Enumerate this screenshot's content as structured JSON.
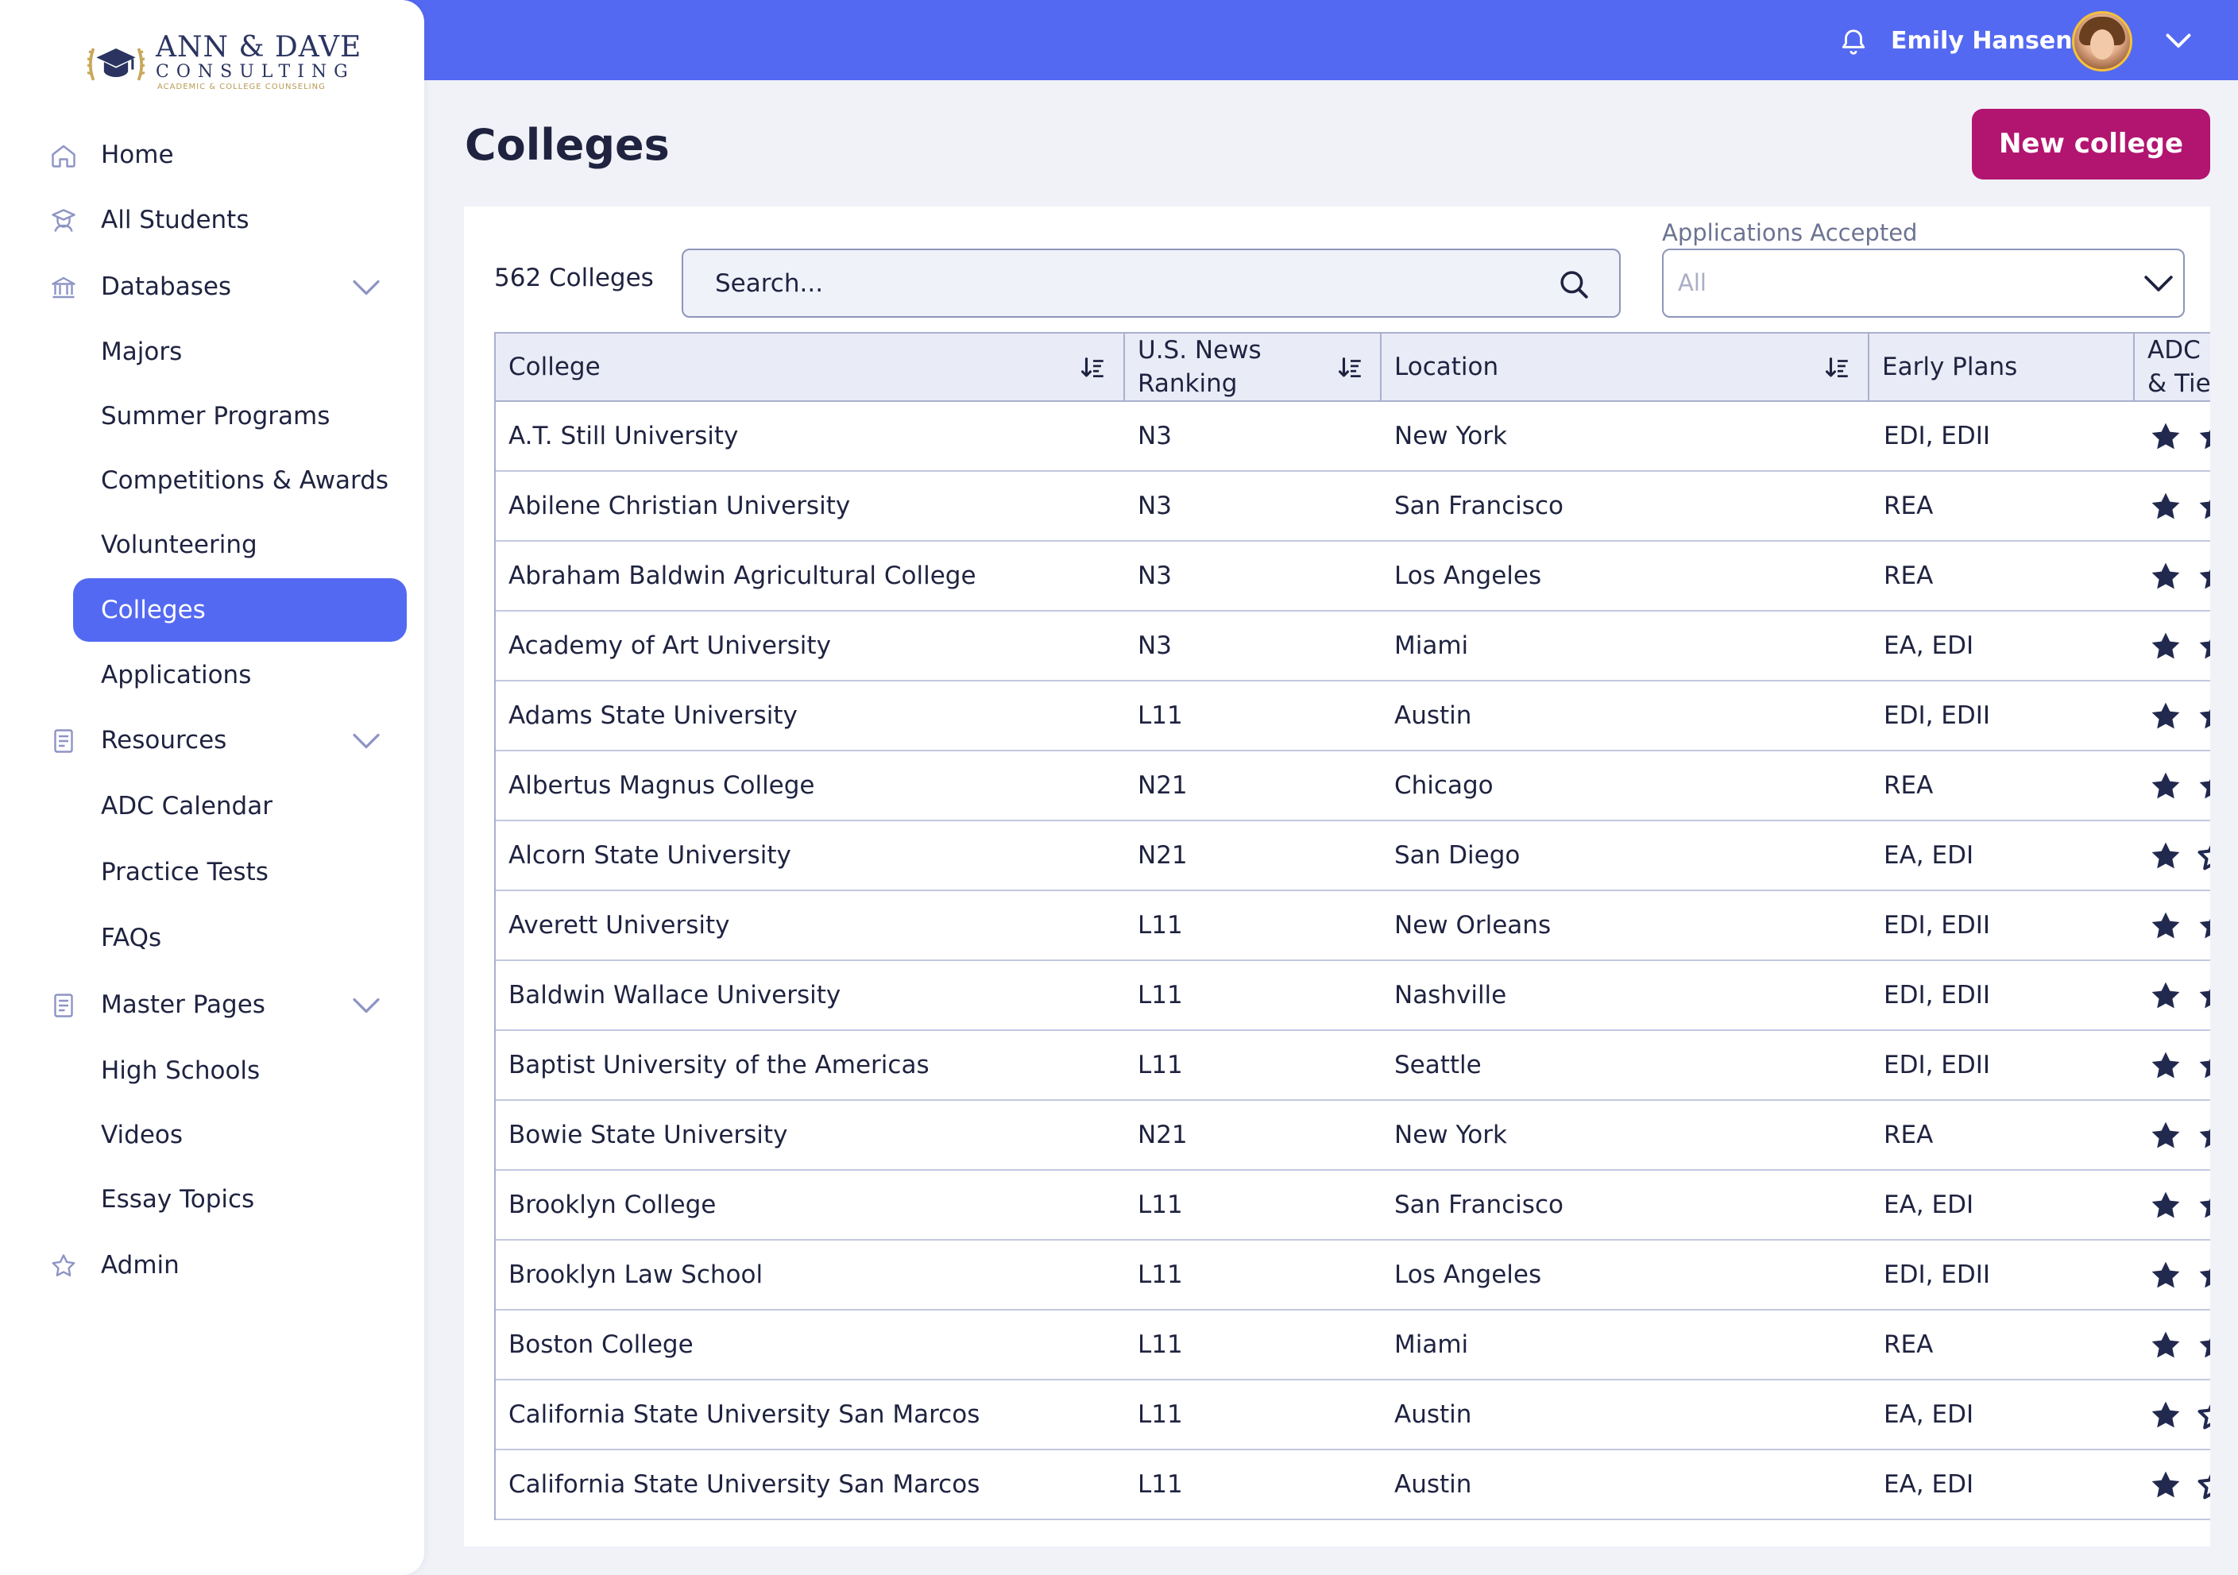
{
  "header": {
    "user_name": "Emily Hansen"
  },
  "logo": {
    "name": "ANN & DAVE",
    "subtitle": "CONSULTING",
    "tagline": "ACADEMIC & COLLEGE COUNSELING"
  },
  "sidebar": {
    "items": [
      {
        "label": "Home",
        "icon": "home-icon"
      },
      {
        "label": "All Students",
        "icon": "graduate-icon"
      },
      {
        "label": "Databases",
        "icon": "bank-icon",
        "expandable": true
      },
      {
        "label": "Majors"
      },
      {
        "label": "Summer Programs"
      },
      {
        "label": "Competitions & Awards"
      },
      {
        "label": "Volunteering"
      },
      {
        "label": "Colleges",
        "active": true
      },
      {
        "label": "Applications"
      },
      {
        "label": "Resources",
        "icon": "document-icon",
        "expandable": true
      },
      {
        "label": "ADC Calendar"
      },
      {
        "label": "Practice Tests"
      },
      {
        "label": "FAQs"
      },
      {
        "label": "Master Pages",
        "icon": "document-icon",
        "expandable": true
      },
      {
        "label": "High Schools"
      },
      {
        "label": "Videos"
      },
      {
        "label": "Essay Topics"
      },
      {
        "label": "Admin",
        "icon": "star-outline-icon"
      }
    ]
  },
  "main": {
    "title": "Colleges",
    "new_button": "New college",
    "count": "562 Colleges",
    "search_placeholder": "Search...",
    "filter_label": "Applications Accepted",
    "filter_value": "All"
  },
  "table": {
    "headers": {
      "college": "College",
      "ranking_line1": "U.S. News",
      "ranking_line2": "Ranking",
      "location": "Location",
      "early_plans": "Early Plans",
      "adc_line1": "ADC F",
      "adc_line2": "& Tier"
    },
    "rows": [
      {
        "college": "A.T. Still University",
        "ranking": "N3",
        "location": "New York",
        "plans": "EDI, EDII",
        "second_star": "filled"
      },
      {
        "college": "Abilene Christian University",
        "ranking": "N3",
        "location": "San Francisco",
        "plans": "REA",
        "second_star": "filled"
      },
      {
        "college": "Abraham Baldwin Agricultural College",
        "ranking": "N3",
        "location": "Los Angeles",
        "plans": "REA",
        "second_star": "filled"
      },
      {
        "college": "Academy of Art University",
        "ranking": "N3",
        "location": "Miami",
        "plans": "EA, EDI",
        "second_star": "filled"
      },
      {
        "college": "Adams State University",
        "ranking": "L11",
        "location": "Austin",
        "plans": "EDI, EDII",
        "second_star": "filled"
      },
      {
        "college": "Albertus Magnus College",
        "ranking": "N21",
        "location": "Chicago",
        "plans": "REA",
        "second_star": "filled"
      },
      {
        "college": "Alcorn State University",
        "ranking": "N21",
        "location": "San Diego",
        "plans": "EA, EDI",
        "second_star": "outline"
      },
      {
        "college": "Averett University",
        "ranking": "L11",
        "location": "New Orleans",
        "plans": "EDI, EDII",
        "second_star": "filled"
      },
      {
        "college": "Baldwin Wallace University",
        "ranking": "L11",
        "location": "Nashville",
        "plans": "EDI, EDII",
        "second_star": "filled"
      },
      {
        "college": "Baptist University of the Americas",
        "ranking": "L11",
        "location": "Seattle",
        "plans": "EDI, EDII",
        "second_star": "filled"
      },
      {
        "college": "Bowie State University",
        "ranking": "N21",
        "location": "New York",
        "plans": "REA",
        "second_star": "filled"
      },
      {
        "college": "Brooklyn College",
        "ranking": "L11",
        "location": "San Francisco",
        "plans": "EA, EDI",
        "second_star": "filled"
      },
      {
        "college": "Brooklyn Law School",
        "ranking": "L11",
        "location": "Los Angeles",
        "plans": "EDI, EDII",
        "second_star": "filled"
      },
      {
        "college": "Boston College",
        "ranking": "L11",
        "location": "Miami",
        "plans": "REA",
        "second_star": "filled"
      },
      {
        "college": "California State University San Marcos",
        "ranking": "L11",
        "location": "Austin",
        "plans": "EA, EDI",
        "second_star": "outline"
      },
      {
        "college": "California State University San Marcos",
        "ranking": "L11",
        "location": "Austin",
        "plans": "EA, EDI",
        "second_star": "outline"
      }
    ]
  },
  "colors": {
    "primary": "#5469f2",
    "accent": "#b21570",
    "text": "#1f2340",
    "star": "#22294f"
  }
}
